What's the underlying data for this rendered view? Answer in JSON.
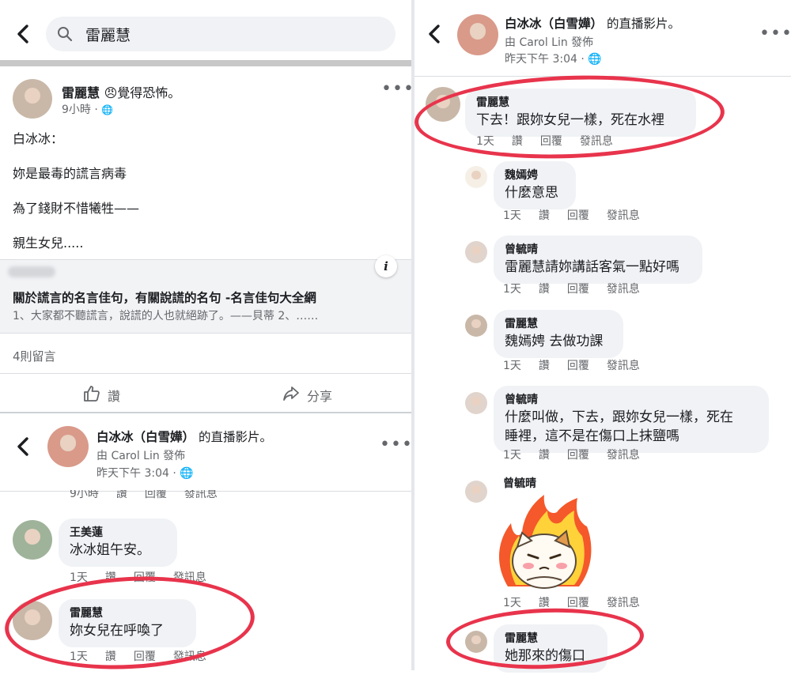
{
  "left": {
    "search": {
      "value": "雷麗慧"
    },
    "post": {
      "author": "雷麗慧",
      "feeling_emoji": "😠",
      "feeling": "覺得恐怖。",
      "time": "9小時",
      "globe": "🌐",
      "lines": [
        "白冰冰：",
        "妳是最毒的謊言病毒",
        "為了錢財不惜犧牲——",
        "親生女兒....."
      ],
      "link_title": "關於謊言的名言佳句，有關說謊的名句 -名言佳句大全網",
      "link_desc": "1、大家都不聽謊言，說謊的人也就絕跡了。——貝蒂 2、……",
      "info_icon": "i",
      "comment_count": "4則留言",
      "like_label": "讚",
      "share_label": "分享"
    },
    "video_header": {
      "page": "白冰冰（白雪嬅）",
      "suffix": "的直播影片。",
      "posted_by": "由 Carol Lin 發佈",
      "time": "昨天下午 3:04 · 🌐"
    },
    "partial_actions": {
      "time": "9小時",
      "like": "讚",
      "reply": "回覆",
      "message": "發訊息"
    },
    "comments": [
      {
        "name": "王美蓮",
        "text": "冰冰姐午安。",
        "time": "1天",
        "like": "讚",
        "reply": "回覆",
        "message": "發訊息"
      },
      {
        "name": "雷麗慧",
        "text": "妳女兒在呼喚了",
        "time": "1天",
        "like": "讚",
        "reply": "回覆",
        "message": "發訊息"
      }
    ]
  },
  "right": {
    "video_header": {
      "page": "白冰冰（白雪嬅）",
      "suffix": "的直播影片。",
      "posted_by": "由 Carol Lin 發佈",
      "time": "昨天下午 3:04 · 🌐"
    },
    "comments": [
      {
        "name": "雷麗慧",
        "text": "下去！跟妳女兒一樣，死在水裡",
        "time": "1天",
        "like": "讚",
        "reply": "回覆",
        "message": "發訊息"
      },
      {
        "name": "魏嫣娉",
        "text": "什麼意思",
        "time": "1天",
        "like": "讚",
        "reply": "回覆",
        "message": "發訊息"
      },
      {
        "name": "曾毓晴",
        "text": "雷麗慧請妳講話客氣一點好嗎",
        "time": "1天",
        "like": "讚",
        "reply": "回覆",
        "message": "發訊息"
      },
      {
        "name": "雷麗慧",
        "text": "魏嫣娉 去做功課",
        "time": "1天",
        "like": "讚",
        "reply": "回覆",
        "message": "發訊息"
      },
      {
        "name": "曾毓晴",
        "text_line1": "什麼叫做，下去，跟妳女兒一樣，死在",
        "text_line2": "睡裡，這不是在傷口上抹鹽嗎",
        "time": "1天",
        "like": "讚",
        "reply": "回覆",
        "message": "發訊息"
      },
      {
        "name": "曾毓晴",
        "sticker": "angry-cat-sticker",
        "time": "1天",
        "like": "讚",
        "reply": "回覆",
        "message": "發訊息"
      },
      {
        "name": "雷麗慧",
        "text": "她那來的傷口"
      }
    ]
  },
  "colors": {
    "highlight_ring": "#e8344c",
    "bubble": "#f0f2f5",
    "meta": "#65676b"
  }
}
